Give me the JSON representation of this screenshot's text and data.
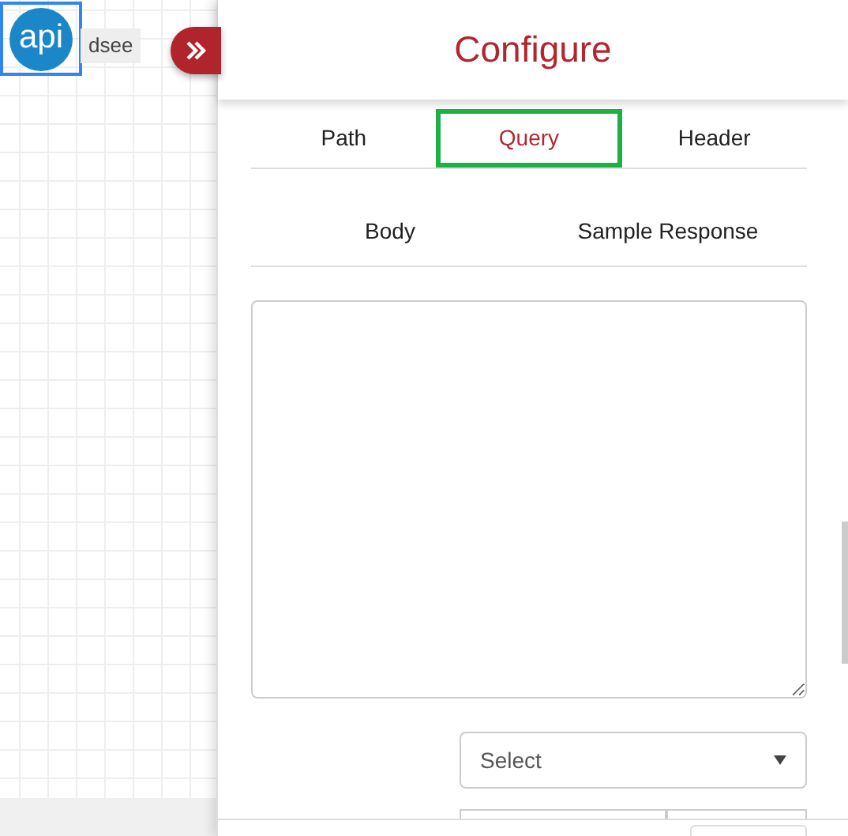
{
  "canvas": {
    "node": {
      "label": "api",
      "selected": true,
      "caption": "dsee"
    }
  },
  "panel": {
    "title": "Configure",
    "tabs": [
      {
        "label": "Path",
        "selected": false
      },
      {
        "label": "Query",
        "selected": true
      },
      {
        "label": "Header",
        "selected": false
      }
    ],
    "tabs_row_2": [
      {
        "label": "Body",
        "selected": false
      },
      {
        "label": "Sample Response",
        "selected": false
      }
    ],
    "select": {
      "value": "Select"
    }
  }
}
